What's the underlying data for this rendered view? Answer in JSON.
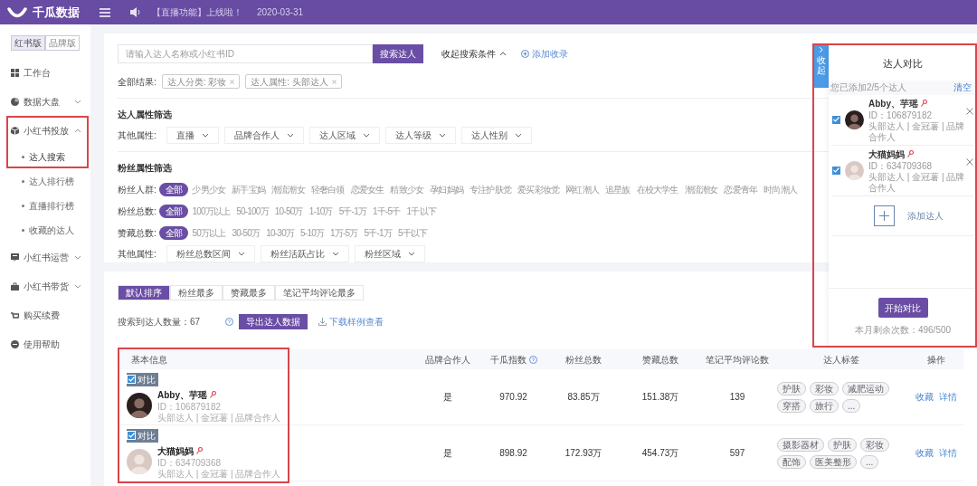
{
  "top_bar": {
    "logo": "千瓜数据",
    "announcement": "【直播功能】上线啦！",
    "date": "2020-03-31"
  },
  "sidebar": {
    "versions": [
      {
        "label": "红书版",
        "selected": true
      },
      {
        "label": "品牌版",
        "selected": false
      }
    ],
    "items": [
      {
        "kind": "link",
        "label": "工作台"
      },
      {
        "kind": "group",
        "label": "数据大盘",
        "expanded": false
      },
      {
        "kind": "group",
        "label": "小红书投放",
        "expanded": true,
        "highlighted": true,
        "children": [
          {
            "label": "达人搜索",
            "selected": true
          },
          {
            "label": "达人排行榜",
            "selected": false
          },
          {
            "label": "直播排行榜",
            "selected": false
          },
          {
            "label": "收藏的达人",
            "selected": false
          }
        ]
      },
      {
        "kind": "group",
        "label": "小红书运营",
        "expanded": false
      },
      {
        "kind": "group",
        "label": "小红书带货",
        "expanded": false
      },
      {
        "kind": "link",
        "label": "购买续费"
      },
      {
        "kind": "link",
        "label": "使用帮助"
      }
    ]
  },
  "search": {
    "placeholder": "请输入达人名称或小红书ID",
    "button": "搜索达人",
    "toggle": "收起搜索条件",
    "add": "添加收录"
  },
  "results": {
    "label": "全部结果:",
    "chips": [
      "达人分类: 彩妆",
      "达人属性: 头部达人"
    ]
  },
  "creator_filters": {
    "title": "达人属性筛选",
    "label": "其他属性:",
    "dropdowns": [
      "直播",
      "品牌合作人",
      "达人区域",
      "达人等级",
      "达人性别"
    ]
  },
  "fan_filters": {
    "title": "粉丝属性筛选",
    "rows": [
      {
        "label": "粉丝人群:",
        "options": [
          {
            "label": "全部",
            "selected": true
          },
          {
            "label": "少男少女",
            "selected": false
          },
          {
            "label": "新手宝妈",
            "selected": false
          },
          {
            "label": "潮流潮女",
            "selected": false
          },
          {
            "label": "轻奢白领",
            "selected": false
          },
          {
            "label": "恋爱女生",
            "selected": false
          },
          {
            "label": "精致少女",
            "selected": false
          },
          {
            "label": "孕妇妈妈",
            "selected": false
          },
          {
            "label": "专注护肤党",
            "selected": false
          },
          {
            "label": "爱买彩妆党",
            "selected": false
          },
          {
            "label": "网红潮人",
            "selected": false
          },
          {
            "label": "追星族",
            "selected": false
          },
          {
            "label": "在校大学生",
            "selected": false
          },
          {
            "label": "潮流潮女",
            "selected": false
          },
          {
            "label": "恋爱青年",
            "selected": false
          },
          {
            "label": "时尚潮人",
            "selected": false
          }
        ]
      },
      {
        "label": "粉丝总数:",
        "options": [
          {
            "label": "全部",
            "selected": true
          },
          {
            "label": "100万以上",
            "selected": false
          },
          {
            "label": "50-100万",
            "selected": false
          },
          {
            "label": "10-50万",
            "selected": false
          },
          {
            "label": "1-10万",
            "selected": false
          },
          {
            "label": "5千-1万",
            "selected": false
          },
          {
            "label": "1千-5千",
            "selected": false
          },
          {
            "label": "1千以下",
            "selected": false
          }
        ]
      },
      {
        "label": "赞藏总数:",
        "options": [
          {
            "label": "全部",
            "selected": true
          },
          {
            "label": "50万以上",
            "selected": false
          },
          {
            "label": "30-50万",
            "selected": false
          },
          {
            "label": "10-30万",
            "selected": false
          },
          {
            "label": "5-10万",
            "selected": false
          },
          {
            "label": "1万-5万",
            "selected": false
          },
          {
            "label": "5千-1万",
            "selected": false
          },
          {
            "label": "5千以下",
            "selected": false
          }
        ]
      }
    ],
    "other_label": "其他属性:",
    "dropdowns": [
      "粉丝总数区间",
      "粉丝活跃占比",
      "粉丝区域"
    ]
  },
  "sort_tabs": [
    {
      "label": "默认排序",
      "selected": true
    },
    {
      "label": "粉丝最多",
      "selected": false
    },
    {
      "label": "赞藏最多",
      "selected": false
    },
    {
      "label": "笔记平均评论最多",
      "selected": false
    }
  ],
  "summary": {
    "count": "搜索到达人数量：67",
    "export": "导出达人数据",
    "download": "下载样例查看"
  },
  "table": {
    "highlighted": true,
    "columns": [
      "基本信息",
      "品牌合作人",
      "千瓜指数",
      "粉丝总数",
      "赞藏总数",
      "笔记平均评论数",
      "达人标签",
      "操作"
    ],
    "rows": [
      {
        "compare_checked": true,
        "compare_label": "对比",
        "name": "Abby、芋瑶",
        "id": "ID：106879182",
        "meta": "头部达人 | 金冠薯 | 品牌合作人",
        "brand_partner": "是",
        "index": "970.92",
        "fans": "83.85万",
        "likes": "151.38万",
        "avg_comments": "139",
        "tags": [
          "护肤",
          "彩妆",
          "减肥运动",
          "穿搭",
          "旅行",
          "..."
        ],
        "actions": [
          "收藏",
          "详情"
        ]
      },
      {
        "compare_checked": true,
        "compare_label": "对比",
        "name": "大猫妈妈",
        "id": "ID：634709368",
        "meta": "头部达人 | 金冠薯 | 品牌合作人",
        "brand_partner": "是",
        "index": "898.92",
        "fans": "172.93万",
        "likes": "454.73万",
        "avg_comments": "597",
        "tags": [
          "摄影器材",
          "护肤",
          "彩妆",
          "配饰",
          "医美整形",
          "..."
        ],
        "actions": [
          "收藏",
          "详情"
        ]
      }
    ]
  },
  "compare_panel": {
    "highlighted": true,
    "collapse": "收起",
    "title": "达人对比",
    "added": "您已添加2/5个达人",
    "clear": "清空",
    "creators": [
      {
        "checked": true,
        "name": "Abby、芋瑶",
        "id": "ID：106879182",
        "meta": "头部达人 | 金冠薯 | 品牌合作人"
      },
      {
        "checked": true,
        "name": "大猫妈妈",
        "id": "ID：634709368",
        "meta": "头部达人 | 金冠薯 | 品牌合作人"
      }
    ],
    "add": "添加达人",
    "start": "开始对比",
    "remaining": "本月剩余次数：496/500"
  }
}
